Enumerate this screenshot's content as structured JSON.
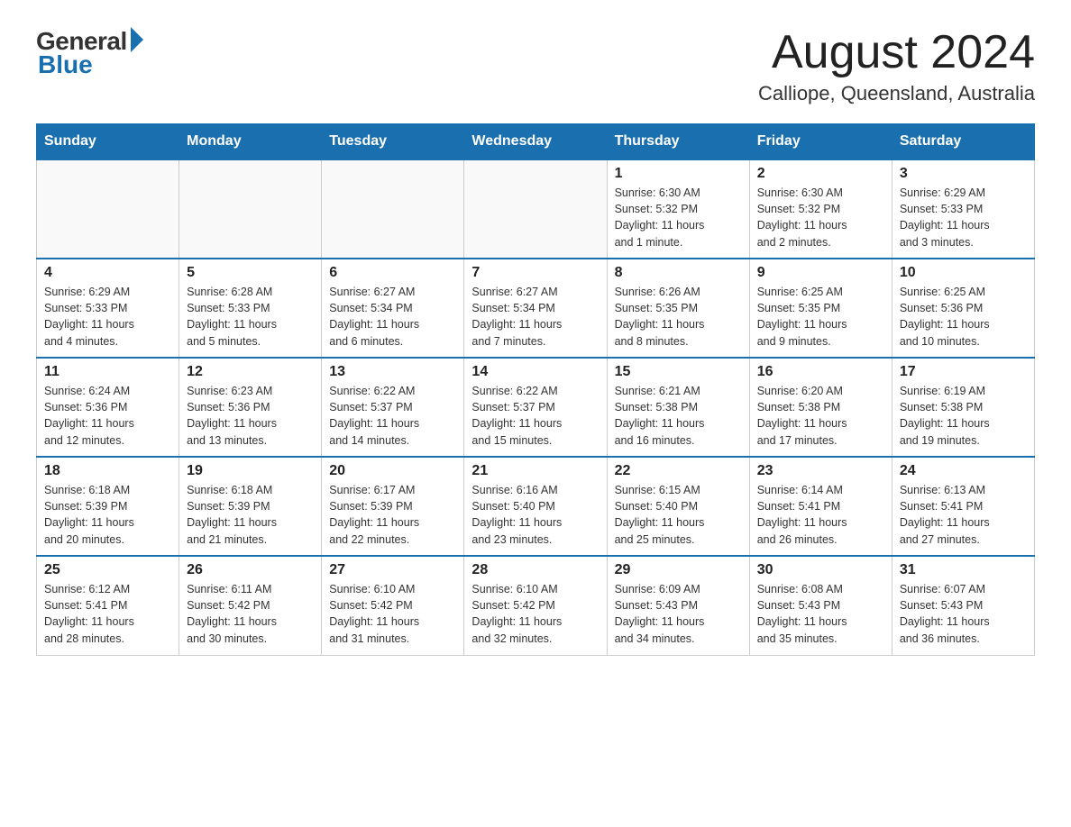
{
  "header": {
    "logo_general": "General",
    "logo_blue": "Blue",
    "month_title": "August 2024",
    "location": "Calliope, Queensland, Australia"
  },
  "days_of_week": [
    "Sunday",
    "Monday",
    "Tuesday",
    "Wednesday",
    "Thursday",
    "Friday",
    "Saturday"
  ],
  "weeks": [
    [
      {
        "day": "",
        "info": ""
      },
      {
        "day": "",
        "info": ""
      },
      {
        "day": "",
        "info": ""
      },
      {
        "day": "",
        "info": ""
      },
      {
        "day": "1",
        "info": "Sunrise: 6:30 AM\nSunset: 5:32 PM\nDaylight: 11 hours\nand 1 minute."
      },
      {
        "day": "2",
        "info": "Sunrise: 6:30 AM\nSunset: 5:32 PM\nDaylight: 11 hours\nand 2 minutes."
      },
      {
        "day": "3",
        "info": "Sunrise: 6:29 AM\nSunset: 5:33 PM\nDaylight: 11 hours\nand 3 minutes."
      }
    ],
    [
      {
        "day": "4",
        "info": "Sunrise: 6:29 AM\nSunset: 5:33 PM\nDaylight: 11 hours\nand 4 minutes."
      },
      {
        "day": "5",
        "info": "Sunrise: 6:28 AM\nSunset: 5:33 PM\nDaylight: 11 hours\nand 5 minutes."
      },
      {
        "day": "6",
        "info": "Sunrise: 6:27 AM\nSunset: 5:34 PM\nDaylight: 11 hours\nand 6 minutes."
      },
      {
        "day": "7",
        "info": "Sunrise: 6:27 AM\nSunset: 5:34 PM\nDaylight: 11 hours\nand 7 minutes."
      },
      {
        "day": "8",
        "info": "Sunrise: 6:26 AM\nSunset: 5:35 PM\nDaylight: 11 hours\nand 8 minutes."
      },
      {
        "day": "9",
        "info": "Sunrise: 6:25 AM\nSunset: 5:35 PM\nDaylight: 11 hours\nand 9 minutes."
      },
      {
        "day": "10",
        "info": "Sunrise: 6:25 AM\nSunset: 5:36 PM\nDaylight: 11 hours\nand 10 minutes."
      }
    ],
    [
      {
        "day": "11",
        "info": "Sunrise: 6:24 AM\nSunset: 5:36 PM\nDaylight: 11 hours\nand 12 minutes."
      },
      {
        "day": "12",
        "info": "Sunrise: 6:23 AM\nSunset: 5:36 PM\nDaylight: 11 hours\nand 13 minutes."
      },
      {
        "day": "13",
        "info": "Sunrise: 6:22 AM\nSunset: 5:37 PM\nDaylight: 11 hours\nand 14 minutes."
      },
      {
        "day": "14",
        "info": "Sunrise: 6:22 AM\nSunset: 5:37 PM\nDaylight: 11 hours\nand 15 minutes."
      },
      {
        "day": "15",
        "info": "Sunrise: 6:21 AM\nSunset: 5:38 PM\nDaylight: 11 hours\nand 16 minutes."
      },
      {
        "day": "16",
        "info": "Sunrise: 6:20 AM\nSunset: 5:38 PM\nDaylight: 11 hours\nand 17 minutes."
      },
      {
        "day": "17",
        "info": "Sunrise: 6:19 AM\nSunset: 5:38 PM\nDaylight: 11 hours\nand 19 minutes."
      }
    ],
    [
      {
        "day": "18",
        "info": "Sunrise: 6:18 AM\nSunset: 5:39 PM\nDaylight: 11 hours\nand 20 minutes."
      },
      {
        "day": "19",
        "info": "Sunrise: 6:18 AM\nSunset: 5:39 PM\nDaylight: 11 hours\nand 21 minutes."
      },
      {
        "day": "20",
        "info": "Sunrise: 6:17 AM\nSunset: 5:39 PM\nDaylight: 11 hours\nand 22 minutes."
      },
      {
        "day": "21",
        "info": "Sunrise: 6:16 AM\nSunset: 5:40 PM\nDaylight: 11 hours\nand 23 minutes."
      },
      {
        "day": "22",
        "info": "Sunrise: 6:15 AM\nSunset: 5:40 PM\nDaylight: 11 hours\nand 25 minutes."
      },
      {
        "day": "23",
        "info": "Sunrise: 6:14 AM\nSunset: 5:41 PM\nDaylight: 11 hours\nand 26 minutes."
      },
      {
        "day": "24",
        "info": "Sunrise: 6:13 AM\nSunset: 5:41 PM\nDaylight: 11 hours\nand 27 minutes."
      }
    ],
    [
      {
        "day": "25",
        "info": "Sunrise: 6:12 AM\nSunset: 5:41 PM\nDaylight: 11 hours\nand 28 minutes."
      },
      {
        "day": "26",
        "info": "Sunrise: 6:11 AM\nSunset: 5:42 PM\nDaylight: 11 hours\nand 30 minutes."
      },
      {
        "day": "27",
        "info": "Sunrise: 6:10 AM\nSunset: 5:42 PM\nDaylight: 11 hours\nand 31 minutes."
      },
      {
        "day": "28",
        "info": "Sunrise: 6:10 AM\nSunset: 5:42 PM\nDaylight: 11 hours\nand 32 minutes."
      },
      {
        "day": "29",
        "info": "Sunrise: 6:09 AM\nSunset: 5:43 PM\nDaylight: 11 hours\nand 34 minutes."
      },
      {
        "day": "30",
        "info": "Sunrise: 6:08 AM\nSunset: 5:43 PM\nDaylight: 11 hours\nand 35 minutes."
      },
      {
        "day": "31",
        "info": "Sunrise: 6:07 AM\nSunset: 5:43 PM\nDaylight: 11 hours\nand 36 minutes."
      }
    ]
  ]
}
